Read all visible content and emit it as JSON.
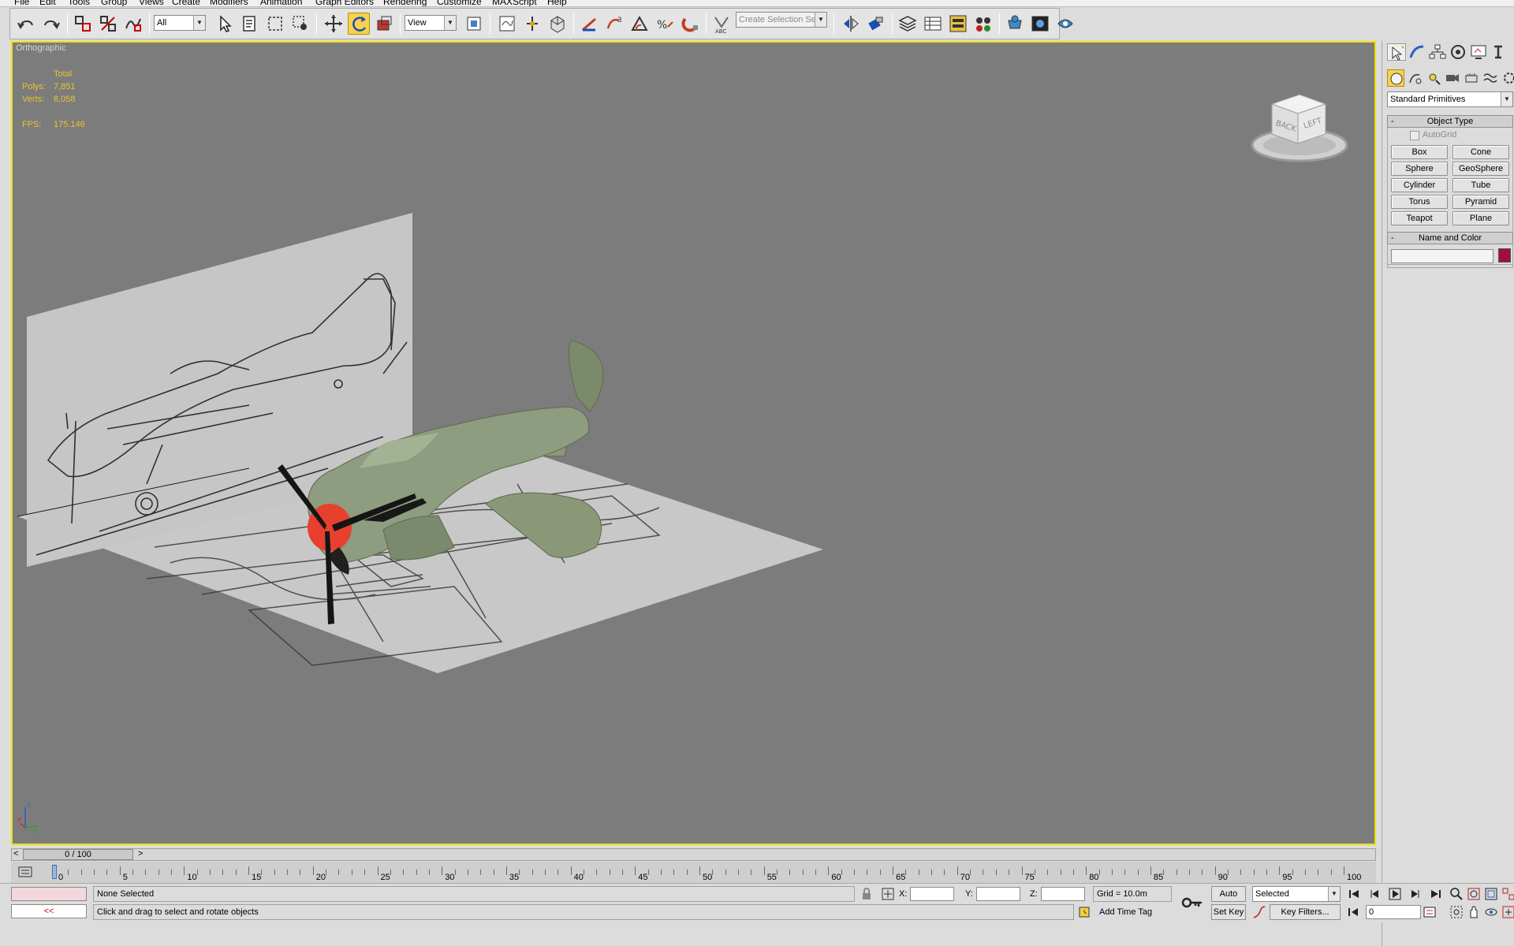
{
  "menu": [
    "File",
    "Edit",
    "Tools",
    "Group",
    "Views",
    "Create",
    "Modifiers",
    "Animation",
    "Graph Editors",
    "Rendering",
    "Customize",
    "MAXScript",
    "Help"
  ],
  "toolbar": {
    "selection_filter": "All",
    "ref_coord": "View",
    "named_selection_placeholder": "Create Selection Set"
  },
  "viewport": {
    "label": "Orthographic",
    "stats": {
      "total_label": "Total",
      "polys_label": "Polys:",
      "polys_value": "7,851",
      "verts_label": "Verts:",
      "verts_value": "8,058",
      "fps_label": "FPS:",
      "fps_value": "175.146"
    },
    "viewcube": {
      "back": "BACK",
      "left": "LEFT"
    },
    "axis": {
      "z": "z",
      "x": "x",
      "y": "y"
    }
  },
  "command_panel": {
    "category": "Standard Primitives",
    "object_type": {
      "title": "Object Type",
      "collapse": "-",
      "autogrid": "AutoGrid",
      "buttons": [
        "Box",
        "Cone",
        "Sphere",
        "GeoSphere",
        "Cylinder",
        "Tube",
        "Torus",
        "Pyramid",
        "Teapot",
        "Plane"
      ]
    },
    "name_and_color": {
      "title": "Name and Color",
      "collapse": "-",
      "color": "#a0103a"
    }
  },
  "timeline": {
    "slider_label": "0 / 100",
    "prev": "<",
    "next": ">",
    "tick_labels": [
      "0",
      "5",
      "10",
      "15",
      "20",
      "25",
      "30",
      "35",
      "40",
      "45",
      "50",
      "55",
      "60",
      "65",
      "70",
      "75",
      "80",
      "85",
      "90",
      "95",
      "100"
    ]
  },
  "status": {
    "selection": "None Selected",
    "prompt": "Click and drag to select and rotate objects",
    "maxscript_arrows": "<<",
    "x_label": "X:",
    "y_label": "Y:",
    "z_label": "Z:",
    "grid": "Grid = 10.0m",
    "add_time_tag": "Add Time Tag",
    "auto_key": "Auto Key",
    "set_key": "Set Key",
    "key_mode": "Selected",
    "key_filters": "Key Filters...",
    "current_frame": "0"
  },
  "colors": {
    "viewport_bg": "#7c7c7c",
    "active_border": "#f2e000",
    "stats_text": "#e8c62a",
    "plane_body": "#8e9c80",
    "spinner": "#e8402e"
  }
}
